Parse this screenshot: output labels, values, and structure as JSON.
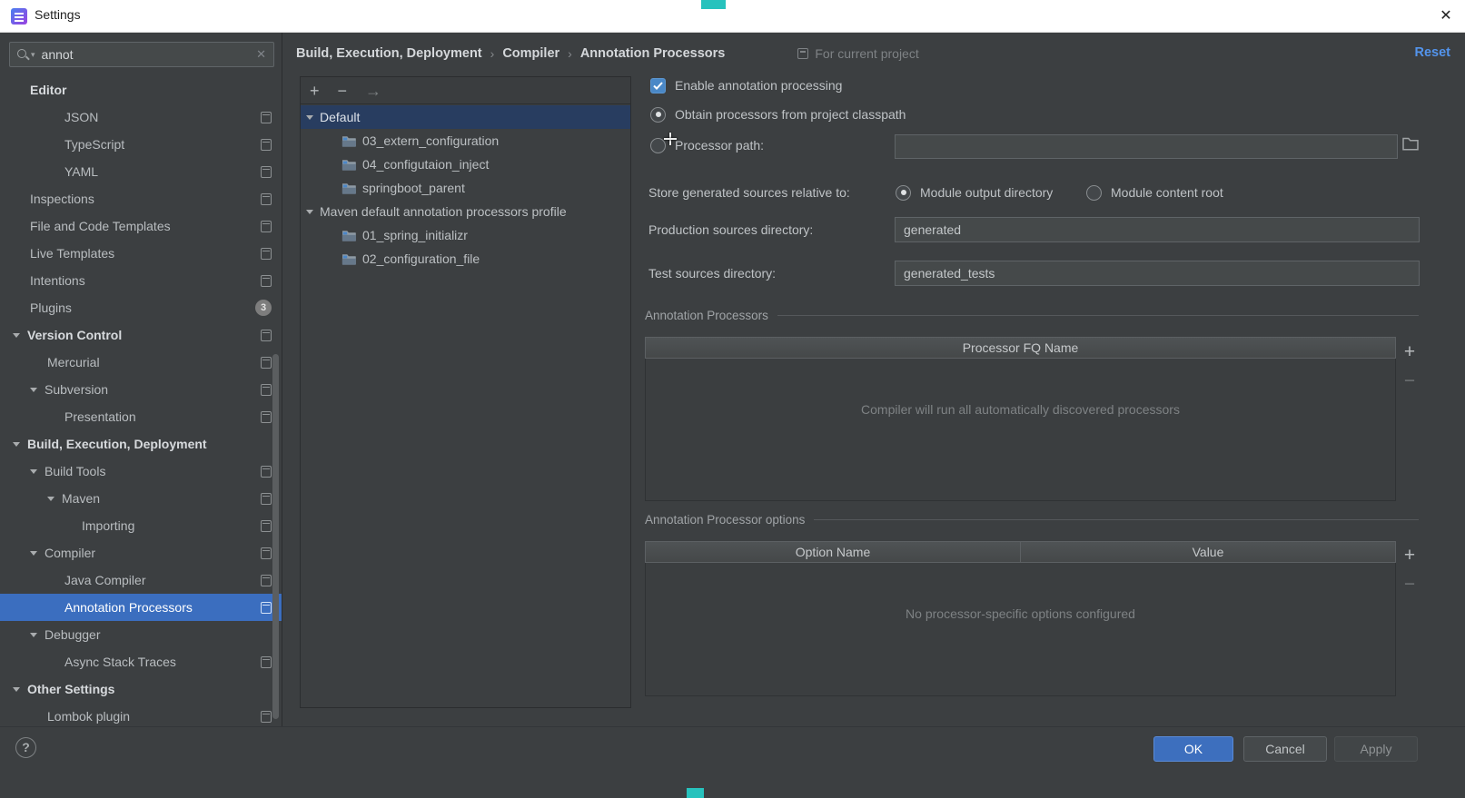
{
  "window": {
    "title": "Settings"
  },
  "icons": {
    "plus": "+",
    "minus": "−",
    "arrow_right": "→",
    "help": "?",
    "close": "✕",
    "clear": "✕",
    "search_chevron": "▾",
    "crumb_separator": "›"
  },
  "sidebar": {
    "search": {
      "value": "annot"
    },
    "items": [
      {
        "label": "Editor",
        "indent": 1,
        "bold": true
      },
      {
        "label": "JSON",
        "indent": 3,
        "icon": true
      },
      {
        "label": "TypeScript",
        "indent": 3,
        "icon": true
      },
      {
        "label": "YAML",
        "indent": 3,
        "icon": true
      },
      {
        "label": "Inspections",
        "indent": 1,
        "icon": true
      },
      {
        "label": "File and Code Templates",
        "indent": 1,
        "icon": true
      },
      {
        "label": "Live Templates",
        "indent": 1,
        "icon": true
      },
      {
        "label": "Intentions",
        "indent": 1,
        "icon": true
      },
      {
        "label": "Plugins",
        "indent": 1,
        "badge": "3"
      },
      {
        "label": "Version Control",
        "indent": 0,
        "bold": true,
        "arrow": true,
        "icon": true
      },
      {
        "label": "Mercurial",
        "indent": 2,
        "icon": true
      },
      {
        "label": "Subversion",
        "indent": 1,
        "arrow": true,
        "icon": true
      },
      {
        "label": "Presentation",
        "indent": 3,
        "icon": true
      },
      {
        "label": "Build, Execution, Deployment",
        "indent": 0,
        "bold": true,
        "arrow": true
      },
      {
        "label": "Build Tools",
        "indent": 1,
        "arrow": true,
        "icon": true
      },
      {
        "label": "Maven",
        "indent": 2,
        "arrow": true,
        "icon": true
      },
      {
        "label": "Importing",
        "indent": 4,
        "icon": true
      },
      {
        "label": "Compiler",
        "indent": 1,
        "arrow": true,
        "icon": true
      },
      {
        "label": "Java Compiler",
        "indent": 3,
        "icon": true
      },
      {
        "label": "Annotation Processors",
        "indent": 3,
        "icon": true,
        "selected": true
      },
      {
        "label": "Debugger",
        "indent": 1,
        "arrow": true
      },
      {
        "label": "Async Stack Traces",
        "indent": 3,
        "icon": true
      },
      {
        "label": "Other Settings",
        "indent": 0,
        "bold": true,
        "arrow": true
      },
      {
        "label": "Lombok plugin",
        "indent": 2,
        "icon": true
      }
    ]
  },
  "breadcrumb": {
    "parts": [
      "Build, Execution, Deployment",
      "Compiler",
      "Annotation Processors"
    ],
    "scope_label": "For current project",
    "reset_label": "Reset"
  },
  "profiles": {
    "tree": [
      {
        "label": "Default",
        "type": "group",
        "selected": true
      },
      {
        "label": "03_extern_configuration",
        "type": "module"
      },
      {
        "label": "04_configutaion_inject",
        "type": "module"
      },
      {
        "label": "springboot_parent",
        "type": "module"
      },
      {
        "label": "Maven default annotation processors profile",
        "type": "group"
      },
      {
        "label": "01_spring_initializr",
        "type": "module"
      },
      {
        "label": "02_configuration_file",
        "type": "module"
      }
    ]
  },
  "form": {
    "enable_label": "Enable annotation processing",
    "obtain_label": "Obtain processors from project classpath",
    "processor_path_label": "Processor path:",
    "processor_path_value": "",
    "store_label": "Store generated sources relative to:",
    "module_output_label": "Module output directory",
    "module_content_label": "Module content root",
    "production_label": "Production sources directory:",
    "production_value": "generated",
    "test_label": "Test sources directory:",
    "test_value": "generated_tests",
    "processors_section_title": "Annotation Processors",
    "fq_name_header": "Processor FQ Name",
    "fq_name_empty": "Compiler will run all automatically discovered processors",
    "options_section_title": "Annotation Processor options",
    "option_name_header": "Option Name",
    "value_header": "Value",
    "options_empty": "No processor-specific options configured"
  },
  "footer": {
    "ok_label": "OK",
    "cancel_label": "Cancel",
    "apply_label": "Apply"
  }
}
